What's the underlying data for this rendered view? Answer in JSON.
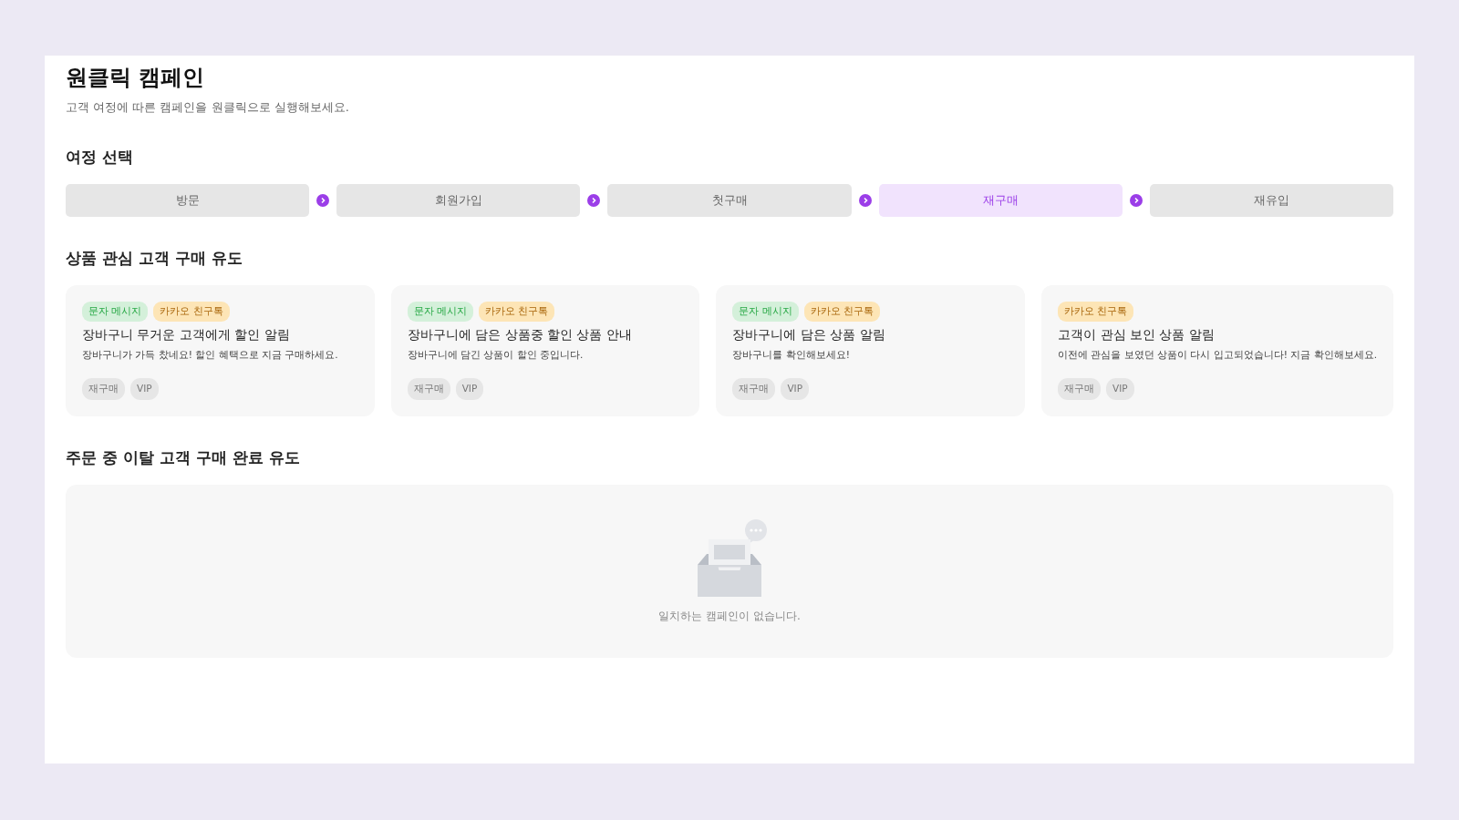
{
  "header": {
    "title": "원클릭 캠페인",
    "subtitle": "고객 여정에 따른 캠페인을 원클릭으로 실행해보세요."
  },
  "journey": {
    "title": "여정 선택",
    "steps": [
      {
        "label": "방문",
        "selected": false
      },
      {
        "label": "회원가입",
        "selected": false
      },
      {
        "label": "첫구매",
        "selected": false
      },
      {
        "label": "재구매",
        "selected": true
      },
      {
        "label": "재유입",
        "selected": false
      }
    ]
  },
  "sections": [
    {
      "title": "상품 관심 고객 구매 유도",
      "cards": [
        {
          "channels": [
            {
              "kind": "sms",
              "label": "문자 메시지"
            },
            {
              "kind": "kakao",
              "label": "카카오 친구톡"
            }
          ],
          "title": "장바구니 무거운 고객에게 할인 알림",
          "description": "장바구니가 가득 찼네요! 할인 혜택으로 지금 구매하세요.",
          "tags": [
            "재구매",
            "VIP"
          ]
        },
        {
          "channels": [
            {
              "kind": "sms",
              "label": "문자 메시지"
            },
            {
              "kind": "kakao",
              "label": "카카오 친구톡"
            }
          ],
          "title": "장바구니에 담은 상품중 할인 상품 안내",
          "description": "장바구니에 담긴 상품이 할인 중입니다.",
          "tags": [
            "재구매",
            "VIP"
          ]
        },
        {
          "channels": [
            {
              "kind": "sms",
              "label": "문자 메시지"
            },
            {
              "kind": "kakao",
              "label": "카카오 친구톡"
            }
          ],
          "title": "장바구니에 담은 상품 알림",
          "description": "장바구니를 확인해보세요!",
          "tags": [
            "재구매",
            "VIP"
          ]
        },
        {
          "channels": [
            {
              "kind": "kakao",
              "label": "카카오 친구톡"
            }
          ],
          "title": "고객이 관심 보인 상품 알림",
          "description": "이전에 관심을 보였던 상품이 다시 입고되었습니다! 지금 확인해보세요.",
          "tags": [
            "재구매",
            "VIP"
          ]
        }
      ]
    },
    {
      "title": "주문 중 이탈 고객 구매 완료 유도",
      "empty_message": "일치하는 캠페인이 없습니다."
    }
  ]
}
